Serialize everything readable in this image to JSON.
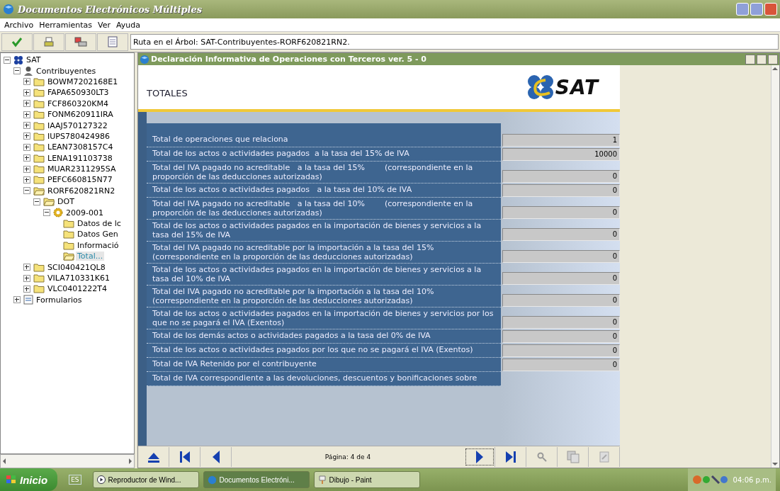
{
  "window": {
    "title": "Documentos Electrónicos Múltiples"
  },
  "menu": [
    "Archivo",
    "Herramientas",
    "Ver",
    "Ayuda"
  ],
  "toolbar": {
    "path": "Ruta en el Árbol: SAT-Contribuyentes-RORF620821RN2."
  },
  "tree": [
    {
      "label": "SAT",
      "kind": "root",
      "expanded": true,
      "selected": false,
      "children": [
        {
          "label": "Contribuyentes",
          "kind": "person",
          "expanded": true,
          "selected": false,
          "children": [
            {
              "label": "BOWM7202168E1",
              "kind": "folder",
              "expanded": false,
              "selected": false
            },
            {
              "label": "FAPA650930LT3",
              "kind": "folder",
              "expanded": false,
              "selected": false
            },
            {
              "label": "FCF860320KM4",
              "kind": "folder",
              "expanded": false,
              "selected": false
            },
            {
              "label": "FONM620911IRA",
              "kind": "folder",
              "expanded": false,
              "selected": false
            },
            {
              "label": "IAAJ570127322",
              "kind": "folder",
              "expanded": false,
              "selected": false
            },
            {
              "label": "IUPS780424986",
              "kind": "folder",
              "expanded": false,
              "selected": false
            },
            {
              "label": "LEAN7308157C4",
              "kind": "folder",
              "expanded": false,
              "selected": false
            },
            {
              "label": "LENA191103738",
              "kind": "folder",
              "expanded": false,
              "selected": false
            },
            {
              "label": "MUAR2311295SA",
              "kind": "folder",
              "expanded": false,
              "selected": false
            },
            {
              "label": "PEFC660815N77",
              "kind": "folder",
              "expanded": false,
              "selected": false
            },
            {
              "label": "RORF620821RN2",
              "kind": "folder",
              "expanded": true,
              "selected": false,
              "children": [
                {
                  "label": "DOT",
                  "kind": "folder",
                  "expanded": true,
                  "selected": false,
                  "children": [
                    {
                      "label": "2009-001",
                      "kind": "gear",
                      "expanded": true,
                      "selected": false,
                      "children": [
                        {
                          "label": "Datos de lc",
                          "kind": "leaf",
                          "expanded": false,
                          "selected": false
                        },
                        {
                          "label": "Datos Gen",
                          "kind": "leaf",
                          "expanded": false,
                          "selected": false
                        },
                        {
                          "label": "Informació",
                          "kind": "leaf",
                          "expanded": false,
                          "selected": false
                        },
                        {
                          "label": "Total...",
                          "kind": "leaf",
                          "expanded": true,
                          "selected": true
                        }
                      ]
                    }
                  ]
                }
              ]
            },
            {
              "label": "SCI040421QL8",
              "kind": "folder",
              "expanded": false,
              "selected": false
            },
            {
              "label": "VILA710331K61",
              "kind": "folder",
              "expanded": false,
              "selected": false
            },
            {
              "label": "VLC0401222T4",
              "kind": "folder",
              "expanded": false,
              "selected": false
            }
          ]
        },
        {
          "label": "Formularios",
          "kind": "form",
          "expanded": false,
          "selected": false
        }
      ]
    }
  ],
  "document": {
    "title": "Declaración Informativa de Operaciones con Terceros ver. 5 - 0",
    "heading": "TOTALES",
    "logo_text": "SAT",
    "rows": [
      {
        "label": "Total de operaciones que relaciona",
        "value": "1"
      },
      {
        "label": "Total de los actos o actividades pagados  a la tasa del 15% de IVA",
        "value": "10000"
      },
      {
        "label": "Total del IVA pagado no acreditable   a la tasa del 15%        (correspondiente en la proporción de las deducciones autorizadas)",
        "value": "0"
      },
      {
        "label": "Total de los actos o actividades pagados   a la tasa del 10% de IVA",
        "value": "0"
      },
      {
        "label": "Total del IVA pagado no acreditable   a la tasa del 10%        (correspondiente en la proporción de las deducciones autorizadas)",
        "value": "0"
      },
      {
        "label": "Total de los actos o actividades pagados en la importación de bienes y servicios a la tasa del 15% de IVA",
        "value": "0"
      },
      {
        "label": "Total del IVA pagado no acreditable por la importación a la tasa del 15% (correspondiente en la proporción de las deducciones autorizadas)",
        "value": "0"
      },
      {
        "label": "Total de los actos o actividades pagados en la importación de bienes y servicios a la tasa del 10% de IVA",
        "value": "0"
      },
      {
        "label": "Total del IVA pagado no acreditable por la importación a la tasa del 10% (correspondiente en la proporción de las deducciones autorizadas)",
        "value": "0"
      },
      {
        "label": "Total de los actos o actividades pagados en la importación de bienes y servicios por los que no se pagará el IVA (Exentos)",
        "value": "0"
      },
      {
        "label": "Total de los demás actos o actividades pagados a la tasa del 0% de IVA",
        "value": "0"
      },
      {
        "label": "Total de los actos o actividades pagados por los que no se pagará el IVA (Exentos)",
        "value": "0"
      },
      {
        "label": "Total de IVA Retenido por el contribuyente",
        "value": "0"
      },
      {
        "label": "Total de IVA correspondiente a las devoluciones, descuentos y bonificaciones sobre"
      }
    ]
  },
  "pager": {
    "text": "Página: 4  de  4"
  },
  "taskbar": {
    "start": "Inicio",
    "language": "ES",
    "tasks": [
      {
        "label": "Reproductor de Wind...",
        "kind": "media",
        "selected": false
      },
      {
        "label": "Documentos Electróni...",
        "kind": "app",
        "selected": true
      },
      {
        "label": "Dibujo - Paint",
        "kind": "paint",
        "selected": false
      }
    ],
    "clock": "04:06 p.m."
  }
}
